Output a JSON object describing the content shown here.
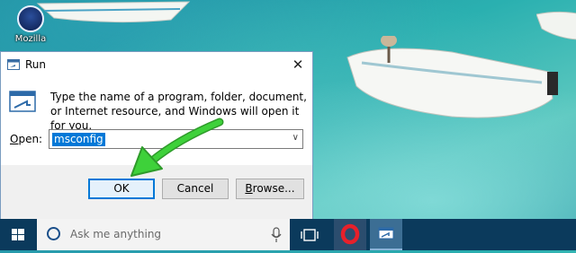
{
  "desktop": {
    "icons": [
      {
        "label": "Mozilla",
        "icon": "firefox-icon"
      }
    ]
  },
  "dialog": {
    "title": "Run",
    "close_label": "✕",
    "description": "Type the name of a program, folder, document, or Internet resource, and Windows will open it for you.",
    "open_label_prefix": "O",
    "open_label_rest": "pen:",
    "command_value": "msconfig",
    "buttons": {
      "ok": "OK",
      "cancel": "Cancel",
      "browse_prefix": "B",
      "browse_rest": "rowse..."
    }
  },
  "taskbar": {
    "search_placeholder": "Ask me anything",
    "apps": [
      "opera-icon",
      "run-icon"
    ]
  },
  "colors": {
    "accent": "#0078d7",
    "annotation": "#3ed13a",
    "taskbar": "#0b3a5c"
  }
}
